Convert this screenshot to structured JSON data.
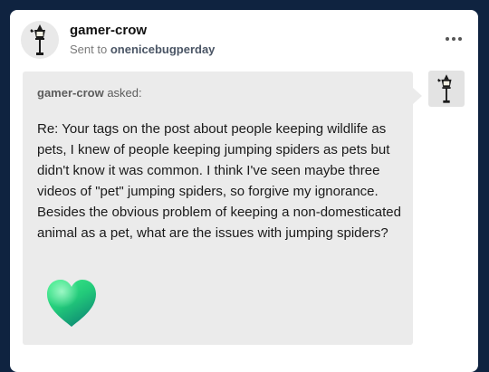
{
  "post": {
    "blog_name": "gamer-crow",
    "sent_to_prefix": "Sent to",
    "recipient": "onenicebugperday"
  },
  "ask": {
    "asker": "gamer-crow",
    "asked_suffix": "asked:",
    "question": "Re: Your tags on the post about people keeping wildlife as pets, I knew of people keeping jumping spiders as pets but didn't know it was common. I think I've seen maybe three videos of \"pet\" jumping spiders, so forgive my ignorance. Besides the obvious problem of keeping a non-domesticated animal as a pet, what are the issues with jumping spiders?"
  },
  "icons": {
    "avatar": "street-lamp-crow-avatar",
    "more": "more-options-icon",
    "heart": "green-heart-emoji"
  },
  "colors": {
    "background": "#0f2340",
    "card": "#ffffff",
    "bubble": "#ebebeb",
    "heart_top": "#2ee07a",
    "heart_bottom": "#129c7a"
  }
}
